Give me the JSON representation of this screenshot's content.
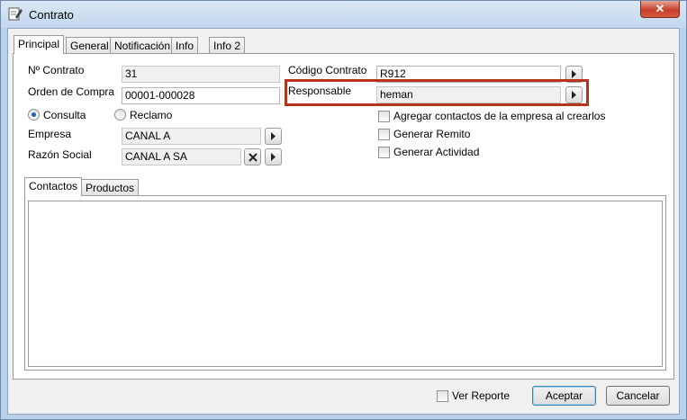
{
  "window": {
    "title": "Contrato",
    "close_label": "✕"
  },
  "tabs": [
    "Principal",
    "General",
    "Notificación",
    "Info",
    "Info 2"
  ],
  "form": {
    "nro_contrato": {
      "label": "Nº Contrato",
      "value": "31"
    },
    "orden_compra": {
      "label": "Orden de Compra",
      "value": "00001-000028"
    },
    "codigo_contrato": {
      "label": "Código Contrato",
      "value": "R912"
    },
    "responsable": {
      "label": "Responsable",
      "value": "heman"
    },
    "tipo_consulta": {
      "label": "Consulta",
      "selected": true
    },
    "tipo_reclamo": {
      "label": "Reclamo",
      "selected": false
    },
    "empresa": {
      "label": "Empresa",
      "value": "CANAL A"
    },
    "razon_social": {
      "label": "Razón Social",
      "value": "CANAL A SA"
    },
    "agregar_contactos": {
      "label": "Agregar contactos de la empresa al crearlos",
      "checked": false
    },
    "generar_remito": {
      "label": "Generar Remito",
      "checked": false
    },
    "generar_actividad": {
      "label": "Generar Actividad",
      "checked": false
    }
  },
  "subtabs": [
    "Contactos",
    "Productos"
  ],
  "footer": {
    "ver_reporte": {
      "label": "Ver Reporte",
      "checked": false
    },
    "aceptar_label": "Aceptar",
    "cancelar_label": "Cancelar"
  },
  "colors": {
    "highlight": "#b5341c",
    "titlebar": "#c3d7ee",
    "close": "#c7412b"
  }
}
